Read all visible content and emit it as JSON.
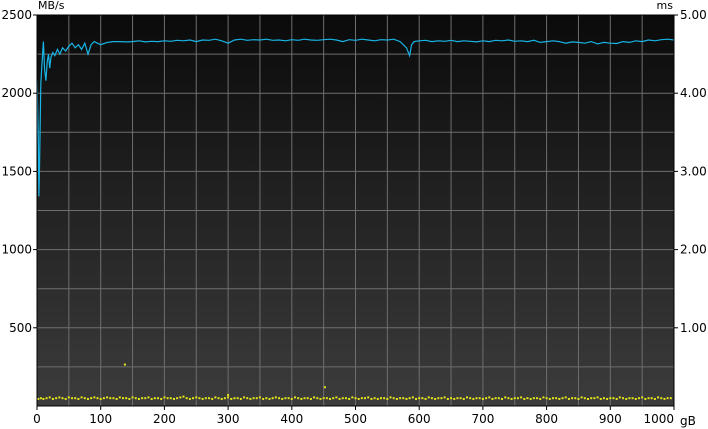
{
  "chart_data": {
    "type": "line",
    "title": "",
    "left_axis": {
      "unit": "MB/s",
      "min": 0,
      "max": 2500,
      "ticks": [
        500,
        1000,
        1500,
        2000,
        2500
      ]
    },
    "right_axis": {
      "unit": "ms",
      "min": 0,
      "max": 5,
      "ticks": [
        "1.00",
        "2.00",
        "3.00",
        "4.00",
        "5.00"
      ]
    },
    "x_axis": {
      "unit": "gB",
      "min": 0,
      "max": 1000,
      "ticks": [
        0,
        100,
        200,
        300,
        400,
        500,
        600,
        700,
        800,
        900,
        1000
      ]
    },
    "grid": true,
    "colors": {
      "transfer_rate": "#19b4e6",
      "access_time": "#e6e619",
      "background_top": "#0a0a0a",
      "background_bottom": "#3c3c3c",
      "grid": "#6e6e6e"
    },
    "series": [
      {
        "axis": "left",
        "style": "line",
        "x": [
          0,
          2,
          3,
          4,
          5,
          6,
          8,
          10,
          12,
          14,
          16,
          18,
          20,
          22,
          25,
          28,
          32,
          36,
          40,
          45,
          50,
          55,
          60,
          65,
          70,
          75,
          80,
          85,
          90,
          95,
          100,
          110,
          120,
          130,
          140,
          150,
          160,
          170,
          180,
          190,
          200,
          210,
          220,
          230,
          240,
          250,
          260,
          270,
          280,
          290,
          300,
          310,
          320,
          330,
          340,
          350,
          360,
          370,
          380,
          390,
          400,
          410,
          420,
          430,
          440,
          450,
          460,
          470,
          480,
          490,
          500,
          510,
          520,
          530,
          540,
          550,
          560,
          570,
          580,
          585,
          588,
          592,
          600,
          610,
          620,
          630,
          640,
          650,
          660,
          670,
          680,
          690,
          700,
          710,
          720,
          730,
          740,
          750,
          760,
          770,
          780,
          790,
          800,
          810,
          820,
          830,
          840,
          850,
          860,
          870,
          880,
          890,
          900,
          910,
          920,
          930,
          940,
          950,
          960,
          970,
          980,
          990,
          1000
        ],
        "y": [
          2090,
          1700,
          1340,
          1520,
          1800,
          2060,
          2200,
          2330,
          2150,
          2080,
          2200,
          2250,
          2160,
          2230,
          2260,
          2240,
          2280,
          2250,
          2290,
          2270,
          2300,
          2320,
          2290,
          2310,
          2280,
          2320,
          2250,
          2310,
          2330,
          2320,
          2310,
          2325,
          2330,
          2330,
          2328,
          2330,
          2335,
          2328,
          2332,
          2330,
          2335,
          2332,
          2338,
          2335,
          2340,
          2330,
          2340,
          2338,
          2345,
          2335,
          2320,
          2340,
          2345,
          2338,
          2342,
          2340,
          2345,
          2338,
          2340,
          2335,
          2342,
          2338,
          2345,
          2340,
          2338,
          2342,
          2345,
          2340,
          2330,
          2342,
          2338,
          2345,
          2340,
          2335,
          2342,
          2340,
          2345,
          2330,
          2290,
          2240,
          2310,
          2330,
          2335,
          2338,
          2330,
          2335,
          2332,
          2338,
          2330,
          2335,
          2332,
          2328,
          2335,
          2330,
          2338,
          2335,
          2340,
          2332,
          2335,
          2330,
          2338,
          2325,
          2330,
          2335,
          2330,
          2320,
          2328,
          2325,
          2320,
          2330,
          2315,
          2325,
          2320,
          2318,
          2330,
          2325,
          2335,
          2330,
          2340,
          2335,
          2342,
          2345,
          2340
        ]
      },
      {
        "axis": "right",
        "style": "points",
        "x": [
          2,
          6,
          10,
          15,
          20,
          25,
          30,
          35,
          40,
          45,
          50,
          55,
          60,
          65,
          70,
          75,
          80,
          85,
          90,
          95,
          100,
          105,
          110,
          115,
          120,
          125,
          130,
          135,
          140,
          145,
          150,
          155,
          160,
          165,
          170,
          175,
          180,
          185,
          190,
          195,
          200,
          205,
          210,
          215,
          220,
          225,
          230,
          235,
          240,
          245,
          250,
          255,
          260,
          265,
          270,
          275,
          280,
          285,
          290,
          295,
          300,
          305,
          310,
          315,
          320,
          325,
          330,
          335,
          340,
          345,
          350,
          355,
          360,
          365,
          370,
          375,
          380,
          385,
          390,
          395,
          400,
          405,
          410,
          415,
          420,
          425,
          430,
          435,
          440,
          445,
          450,
          455,
          460,
          465,
          470,
          475,
          480,
          485,
          490,
          495,
          500,
          505,
          510,
          515,
          520,
          525,
          530,
          535,
          540,
          545,
          550,
          555,
          560,
          565,
          570,
          575,
          580,
          585,
          590,
          595,
          600,
          605,
          610,
          615,
          620,
          625,
          630,
          635,
          640,
          645,
          650,
          655,
          660,
          665,
          670,
          675,
          680,
          685,
          690,
          695,
          700,
          705,
          710,
          715,
          720,
          725,
          730,
          735,
          740,
          745,
          750,
          755,
          760,
          765,
          770,
          775,
          780,
          785,
          790,
          795,
          800,
          805,
          810,
          815,
          820,
          825,
          830,
          835,
          840,
          845,
          850,
          855,
          860,
          865,
          870,
          875,
          880,
          885,
          890,
          895,
          900,
          905,
          910,
          915,
          920,
          925,
          930,
          935,
          940,
          945,
          950,
          955,
          960,
          965,
          970,
          975,
          980,
          985,
          990,
          995,
          138,
          300,
          452
        ],
        "y": [
          0.09,
          0.1,
          0.09,
          0.1,
          0.11,
          0.09,
          0.1,
          0.11,
          0.1,
          0.09,
          0.11,
          0.1,
          0.1,
          0.09,
          0.11,
          0.1,
          0.09,
          0.1,
          0.11,
          0.1,
          0.09,
          0.1,
          0.11,
          0.1,
          0.1,
          0.09,
          0.11,
          0.1,
          0.1,
          0.09,
          0.11,
          0.1,
          0.09,
          0.1,
          0.1,
          0.11,
          0.09,
          0.1,
          0.1,
          0.09,
          0.11,
          0.1,
          0.1,
          0.09,
          0.1,
          0.11,
          0.12,
          0.1,
          0.09,
          0.1,
          0.11,
          0.1,
          0.09,
          0.1,
          0.1,
          0.09,
          0.11,
          0.1,
          0.09,
          0.1,
          0.11,
          0.09,
          0.1,
          0.1,
          0.09,
          0.11,
          0.1,
          0.09,
          0.1,
          0.1,
          0.11,
          0.09,
          0.1,
          0.09,
          0.1,
          0.11,
          0.1,
          0.09,
          0.1,
          0.1,
          0.09,
          0.11,
          0.1,
          0.09,
          0.1,
          0.1,
          0.09,
          0.11,
          0.1,
          0.09,
          0.1,
          0.1,
          0.09,
          0.1,
          0.11,
          0.09,
          0.1,
          0.1,
          0.09,
          0.11,
          0.1,
          0.09,
          0.1,
          0.1,
          0.11,
          0.09,
          0.1,
          0.09,
          0.1,
          0.1,
          0.09,
          0.11,
          0.1,
          0.09,
          0.1,
          0.1,
          0.09,
          0.1,
          0.11,
          0.09,
          0.1,
          0.1,
          0.09,
          0.11,
          0.1,
          0.09,
          0.1,
          0.1,
          0.11,
          0.09,
          0.1,
          0.09,
          0.1,
          0.1,
          0.09,
          0.11,
          0.1,
          0.09,
          0.1,
          0.1,
          0.09,
          0.1,
          0.11,
          0.09,
          0.1,
          0.1,
          0.09,
          0.11,
          0.1,
          0.09,
          0.1,
          0.1,
          0.11,
          0.09,
          0.1,
          0.09,
          0.1,
          0.1,
          0.09,
          0.11,
          0.1,
          0.09,
          0.1,
          0.1,
          0.09,
          0.1,
          0.11,
          0.09,
          0.1,
          0.1,
          0.09,
          0.11,
          0.1,
          0.09,
          0.1,
          0.1,
          0.11,
          0.09,
          0.1,
          0.09,
          0.1,
          0.1,
          0.09,
          0.11,
          0.1,
          0.09,
          0.1,
          0.1,
          0.09,
          0.1,
          0.11,
          0.09,
          0.1,
          0.1,
          0.09,
          0.11,
          0.1,
          0.09,
          0.1,
          0.1,
          0.53,
          0.14,
          0.24
        ]
      }
    ]
  }
}
